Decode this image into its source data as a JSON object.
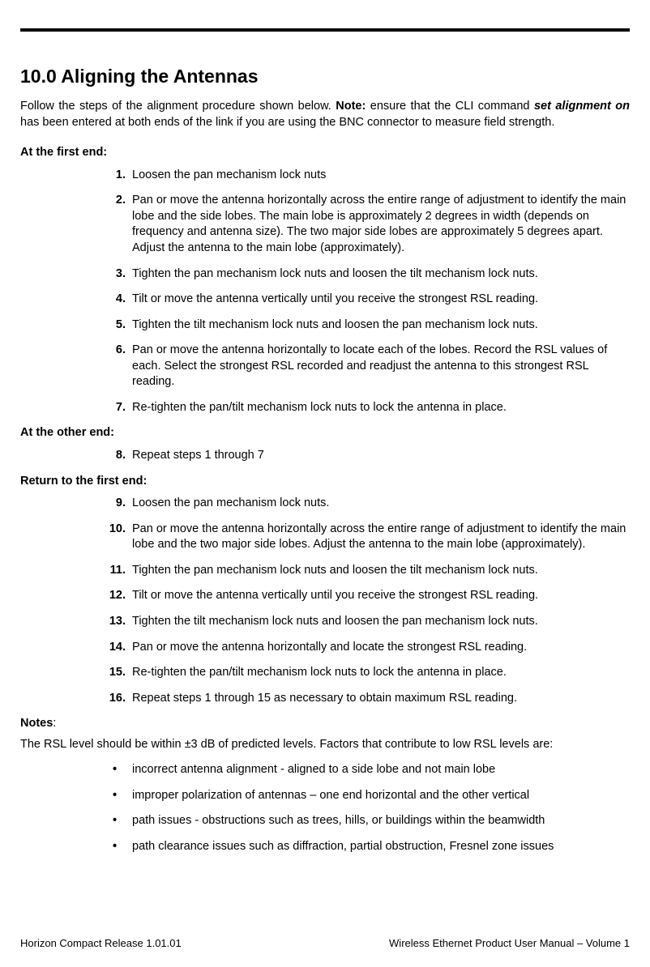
{
  "title": "10.0 Aligning the Antennas",
  "intro": {
    "p1a": "Follow the steps of the alignment procedure shown below. ",
    "note_label": "Note:",
    "p1b": " ensure that the CLI command ",
    "cmd": "set alignment on",
    "p1c": " has been entered at both ends of the link if you are using the BNC connector to measure field strength."
  },
  "sections": {
    "first_end": "At the first end:",
    "other_end": "At the other end:",
    "return_first": "Return to the first end:"
  },
  "steps": {
    "s1": "Loosen the pan mechanism lock nuts",
    "s2": "Pan or move the antenna horizontally across the entire range of adjustment to identify the main lobe and the side lobes. The main lobe is approximately 2 degrees in width (depends on frequency and antenna size). The two major side lobes are approximately 5 degrees apart. Adjust the antenna to the main lobe (approximately).",
    "s3": "Tighten the pan mechanism lock nuts and loosen the tilt mechanism lock nuts.",
    "s4": "Tilt or move the antenna vertically until you receive the strongest RSL reading.",
    "s5": "Tighten the tilt mechanism lock nuts and loosen the pan mechanism lock nuts.",
    "s6": "Pan or move the antenna horizontally to locate each of the lobes. Record the RSL values of each. Select the strongest RSL recorded and readjust the antenna to this strongest RSL reading.",
    "s7": "Re-tighten the pan/tilt mechanism lock nuts to lock the antenna in place.",
    "s8": "Repeat steps 1 through 7",
    "s9": "Loosen the pan mechanism lock nuts.",
    "s10": "Pan or move the antenna horizontally across the entire range of adjustment to identify the main lobe and the two major side lobes. Adjust the antenna to the main lobe (approximately).",
    "s11": "Tighten the pan mechanism lock nuts and loosen the tilt mechanism lock nuts.",
    "s12": "Tilt or move the antenna vertically until you receive the strongest RSL reading.",
    "s13": "Tighten the tilt mechanism lock nuts and loosen the pan mechanism lock nuts.",
    "s14": "Pan or move the antenna horizontally and locate the strongest RSL reading.",
    "s15": "Re-tighten the pan/tilt mechanism lock nuts to lock the antenna in place.",
    "s16": "Repeat steps 1 through 15 as necessary to obtain maximum RSL reading."
  },
  "notes": {
    "label": "Notes",
    "colon": ":",
    "intro": "The RSL level should be within ±3 dB of predicted levels. Factors that contribute to low RSL levels are:",
    "b1": "incorrect antenna alignment - aligned to a side lobe and not main lobe",
    "b2": "improper polarization of antennas – one end horizontal and the other vertical",
    "b3": "path issues - obstructions such as trees, hills, or buildings within the beamwidth",
    "b4": "path clearance issues such as diffraction, partial obstruction, Fresnel zone issues"
  },
  "footer": {
    "left": "Horizon Compact Release 1.01.01",
    "right": "Wireless Ethernet Product User Manual – Volume 1"
  }
}
